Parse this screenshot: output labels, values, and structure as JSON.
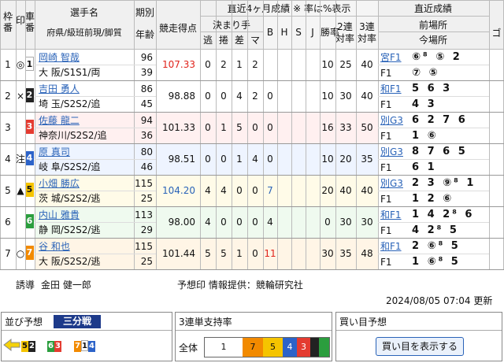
{
  "header": {
    "waku": "枠番",
    "mark": "印",
    "sha": "車番",
    "rider": "選手名",
    "rider_sub": "府県/級班前現/脚質",
    "kibetsu": "期別",
    "nenrei": "年齢",
    "score": "競走得点",
    "recent": "直近4ヶ月成績 ※ 率は%表示",
    "kimarite": "決まり手",
    "nige": "逃",
    "makuri": "捲",
    "sashi": "差",
    "mark2": "マ",
    "b": "B",
    "h": "H",
    "s": "S",
    "j": "J",
    "win": "勝率",
    "rentai2": "2連対率",
    "rentai3": "3連対率",
    "recent2": "直近成績",
    "prev": "前場所",
    "curr": "今場所",
    "g": "ゴ"
  },
  "riders": [
    {
      "waku": "1",
      "mark": "◎",
      "no": "1",
      "name": "岡崎 智哉",
      "pref": "大 阪/S1S1/両",
      "kibetsu": "96",
      "age": "39",
      "score": "107.33",
      "nige": "0",
      "makuri": "2",
      "sashi": "1",
      "mk": "2",
      "b": "",
      "h": "",
      "s": "",
      "j": "",
      "win": "10",
      "r2": "25",
      "r3": "40",
      "prev_venue": "宮F1",
      "prev_results": "⑥⁸ ⑤ 2",
      "curr_venue": "F1",
      "curr_results": "⑦ ⑤",
      "wcolor": "#ffffff",
      "tcolor": "#111111",
      "rowbg": "#ffffff"
    },
    {
      "waku": "2",
      "mark": "×",
      "no": "2",
      "name": "吉田 勇人",
      "pref": "埼 玉/S2S2/追",
      "kibetsu": "86",
      "age": "45",
      "score": "98.88",
      "nige": "0",
      "makuri": "0",
      "sashi": "4",
      "mk": "2",
      "b": "0",
      "h": "",
      "s": "",
      "j": "",
      "win": "10",
      "r2": "30",
      "r3": "40",
      "prev_venue": "和F1",
      "prev_results": "5 6 3",
      "curr_venue": "F1",
      "curr_results": "4 3",
      "wcolor": "#222222",
      "tcolor": "#ffffff",
      "rowbg": "#ffffff"
    },
    {
      "waku": "3",
      "mark": "",
      "no": "3",
      "name": "佐藤 龍二",
      "pref": "神奈川/S2S2/追",
      "kibetsu": "94",
      "age": "36",
      "score": "101.33",
      "nige": "0",
      "makuri": "1",
      "sashi": "5",
      "mk": "0",
      "b": "0",
      "h": "",
      "s": "",
      "j": "",
      "win": "16",
      "r2": "33",
      "r3": "50",
      "prev_venue": "別G3",
      "prev_results": "6 2 7 6",
      "curr_venue": "F1",
      "curr_results": "1 ⑥",
      "wcolor": "#e43b30",
      "tcolor": "#ffffff",
      "rowbg": "#fff0f0"
    },
    {
      "waku": "4",
      "mark": "注",
      "no": "4",
      "name": "原 真司",
      "pref": "岐 阜/S2S2/追",
      "kibetsu": "80",
      "age": "46",
      "score": "98.51",
      "nige": "0",
      "makuri": "0",
      "sashi": "1",
      "mk": "4",
      "b": "0",
      "h": "",
      "s": "",
      "j": "",
      "win": "10",
      "r2": "20",
      "r3": "35",
      "prev_venue": "別G3",
      "prev_results": "8 7 6 5",
      "curr_venue": "F1",
      "curr_results": "6 1",
      "wcolor": "#2c63c9",
      "tcolor": "#ffffff",
      "rowbg": "#eef4ff"
    },
    {
      "waku": "5",
      "mark": "▲",
      "no": "5",
      "name": "小畑 勝広",
      "pref": "茨 城/S2S2/逃",
      "kibetsu": "115",
      "age": "25",
      "score": "104.20",
      "nige": "4",
      "makuri": "4",
      "sashi": "0",
      "mk": "0",
      "b": "7",
      "h": "",
      "s": "",
      "j": "",
      "win": "20",
      "r2": "40",
      "r3": "40",
      "prev_venue": "別G3",
      "prev_results": "2 3 ⑨⁸ 1",
      "curr_venue": "F1",
      "curr_results": "1 2 ⑥",
      "wcolor": "#f5c400",
      "tcolor": "#111111",
      "rowbg": "#fffbe8"
    },
    {
      "waku": "6",
      "mark": "",
      "no": "6",
      "name": "内山 雅貴",
      "pref": "静 岡/S2S2/逃",
      "kibetsu": "113",
      "age": "29",
      "score": "98.00",
      "nige": "4",
      "makuri": "0",
      "sashi": "0",
      "mk": "0",
      "b": "4",
      "h": "",
      "s": "",
      "j": "",
      "win": "0",
      "r2": "30",
      "r3": "30",
      "prev_venue": "和F1",
      "prev_results": "1 4 2⁸ 6",
      "curr_venue": "F1",
      "curr_results": "4 2⁸ 5",
      "wcolor": "#2b9e3e",
      "tcolor": "#ffffff",
      "rowbg": "#effaef"
    },
    {
      "waku": "7",
      "mark": "○",
      "no": "7",
      "name": "谷 和也",
      "pref": "大 阪/S2S2/逃",
      "kibetsu": "115",
      "age": "25",
      "score": "101.44",
      "nige": "5",
      "makuri": "5",
      "sashi": "1",
      "mk": "0",
      "b": "11",
      "h": "",
      "s": "",
      "j": "",
      "win": "30",
      "r2": "35",
      "r3": "48",
      "prev_venue": "和F1",
      "prev_results": "2 ⑥⁸ 5",
      "curr_venue": "F1",
      "curr_results": "1 ⑥⁸ 5",
      "wcolor": "#f28a00",
      "tcolor": "#ffffff",
      "rowbg": "#fff5e6"
    }
  ],
  "footer": {
    "lead_label": "誘導",
    "lead_name": "金田 健一郎",
    "predictor": "予想印 情報提供：競輪研究社",
    "updated": "2024/08/05 07:04 更新"
  },
  "narabi": {
    "title": "並び予想",
    "tab": "三分戦",
    "groups": [
      "52",
      "63",
      "714"
    ]
  },
  "support": {
    "title": "3連単支持率",
    "scope": "全体",
    "cells": [
      "1",
      "7",
      "5",
      "4",
      "3",
      ""
    ]
  },
  "buy": {
    "title": "買い目予想",
    "button": "買い目を表示する"
  },
  "colors": {
    "1": "#ffffff",
    "2": "#222222",
    "3": "#e43b30",
    "4": "#2c63c9",
    "5": "#f5c400",
    "6": "#2b9e3e",
    "7": "#f28a00",
    "link": "#2a63b8",
    "score_red": "#e0231b",
    "score_blue": "#2a63b8"
  }
}
